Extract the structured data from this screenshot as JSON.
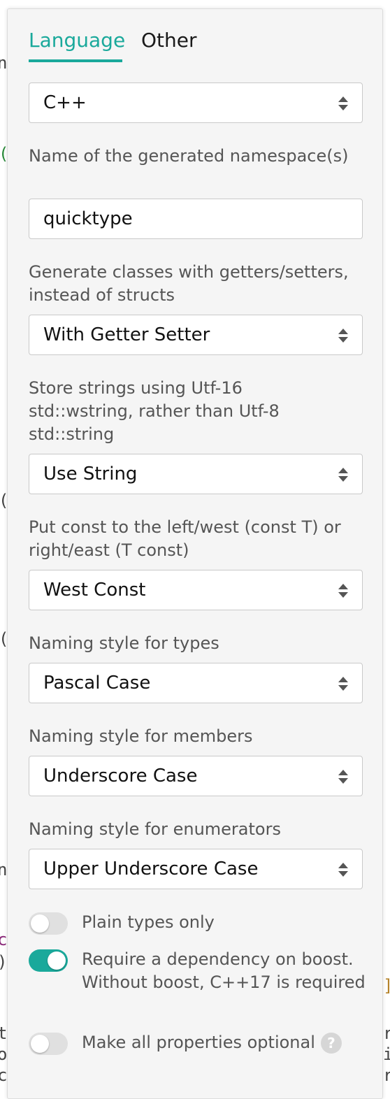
{
  "tabs": [
    {
      "label": "Language",
      "active": true
    },
    {
      "label": "Other",
      "active": false
    }
  ],
  "language_select": {
    "value": "C++"
  },
  "namespace": {
    "label": "Name of the generated namespace(s)",
    "value": "quicktype"
  },
  "class_style": {
    "label": "Generate classes with getters/setters, instead of structs",
    "value": "With Getter Setter"
  },
  "string_type": {
    "label": "Store strings using Utf-16 std::wstring, rather than Utf-8 std::string",
    "value": "Use String"
  },
  "const_style": {
    "label": "Put const to the left/west (const T) or right/east (T const)",
    "value": "West Const"
  },
  "type_naming": {
    "label": "Naming style for types",
    "value": "Pascal Case"
  },
  "member_naming": {
    "label": "Naming style for members",
    "value": "Underscore Case"
  },
  "enumerator_naming": {
    "label": "Naming style for enumerators",
    "value": "Upper Underscore Case"
  },
  "toggles": [
    {
      "label": "Plain types only",
      "on": false
    },
    {
      "label": "Require a dependency on boost. Without boost, C++17 is required",
      "on": true
    },
    {
      "label": "Make all properties optional",
      "on": false,
      "help": "?"
    }
  ],
  "colors": {
    "accent": "#1aa99b",
    "panel_bg": "#f5f5f5",
    "label": "#555555"
  },
  "icons": {
    "select_caret": "up-down-caret-icon",
    "help": "question-circle-icon"
  }
}
